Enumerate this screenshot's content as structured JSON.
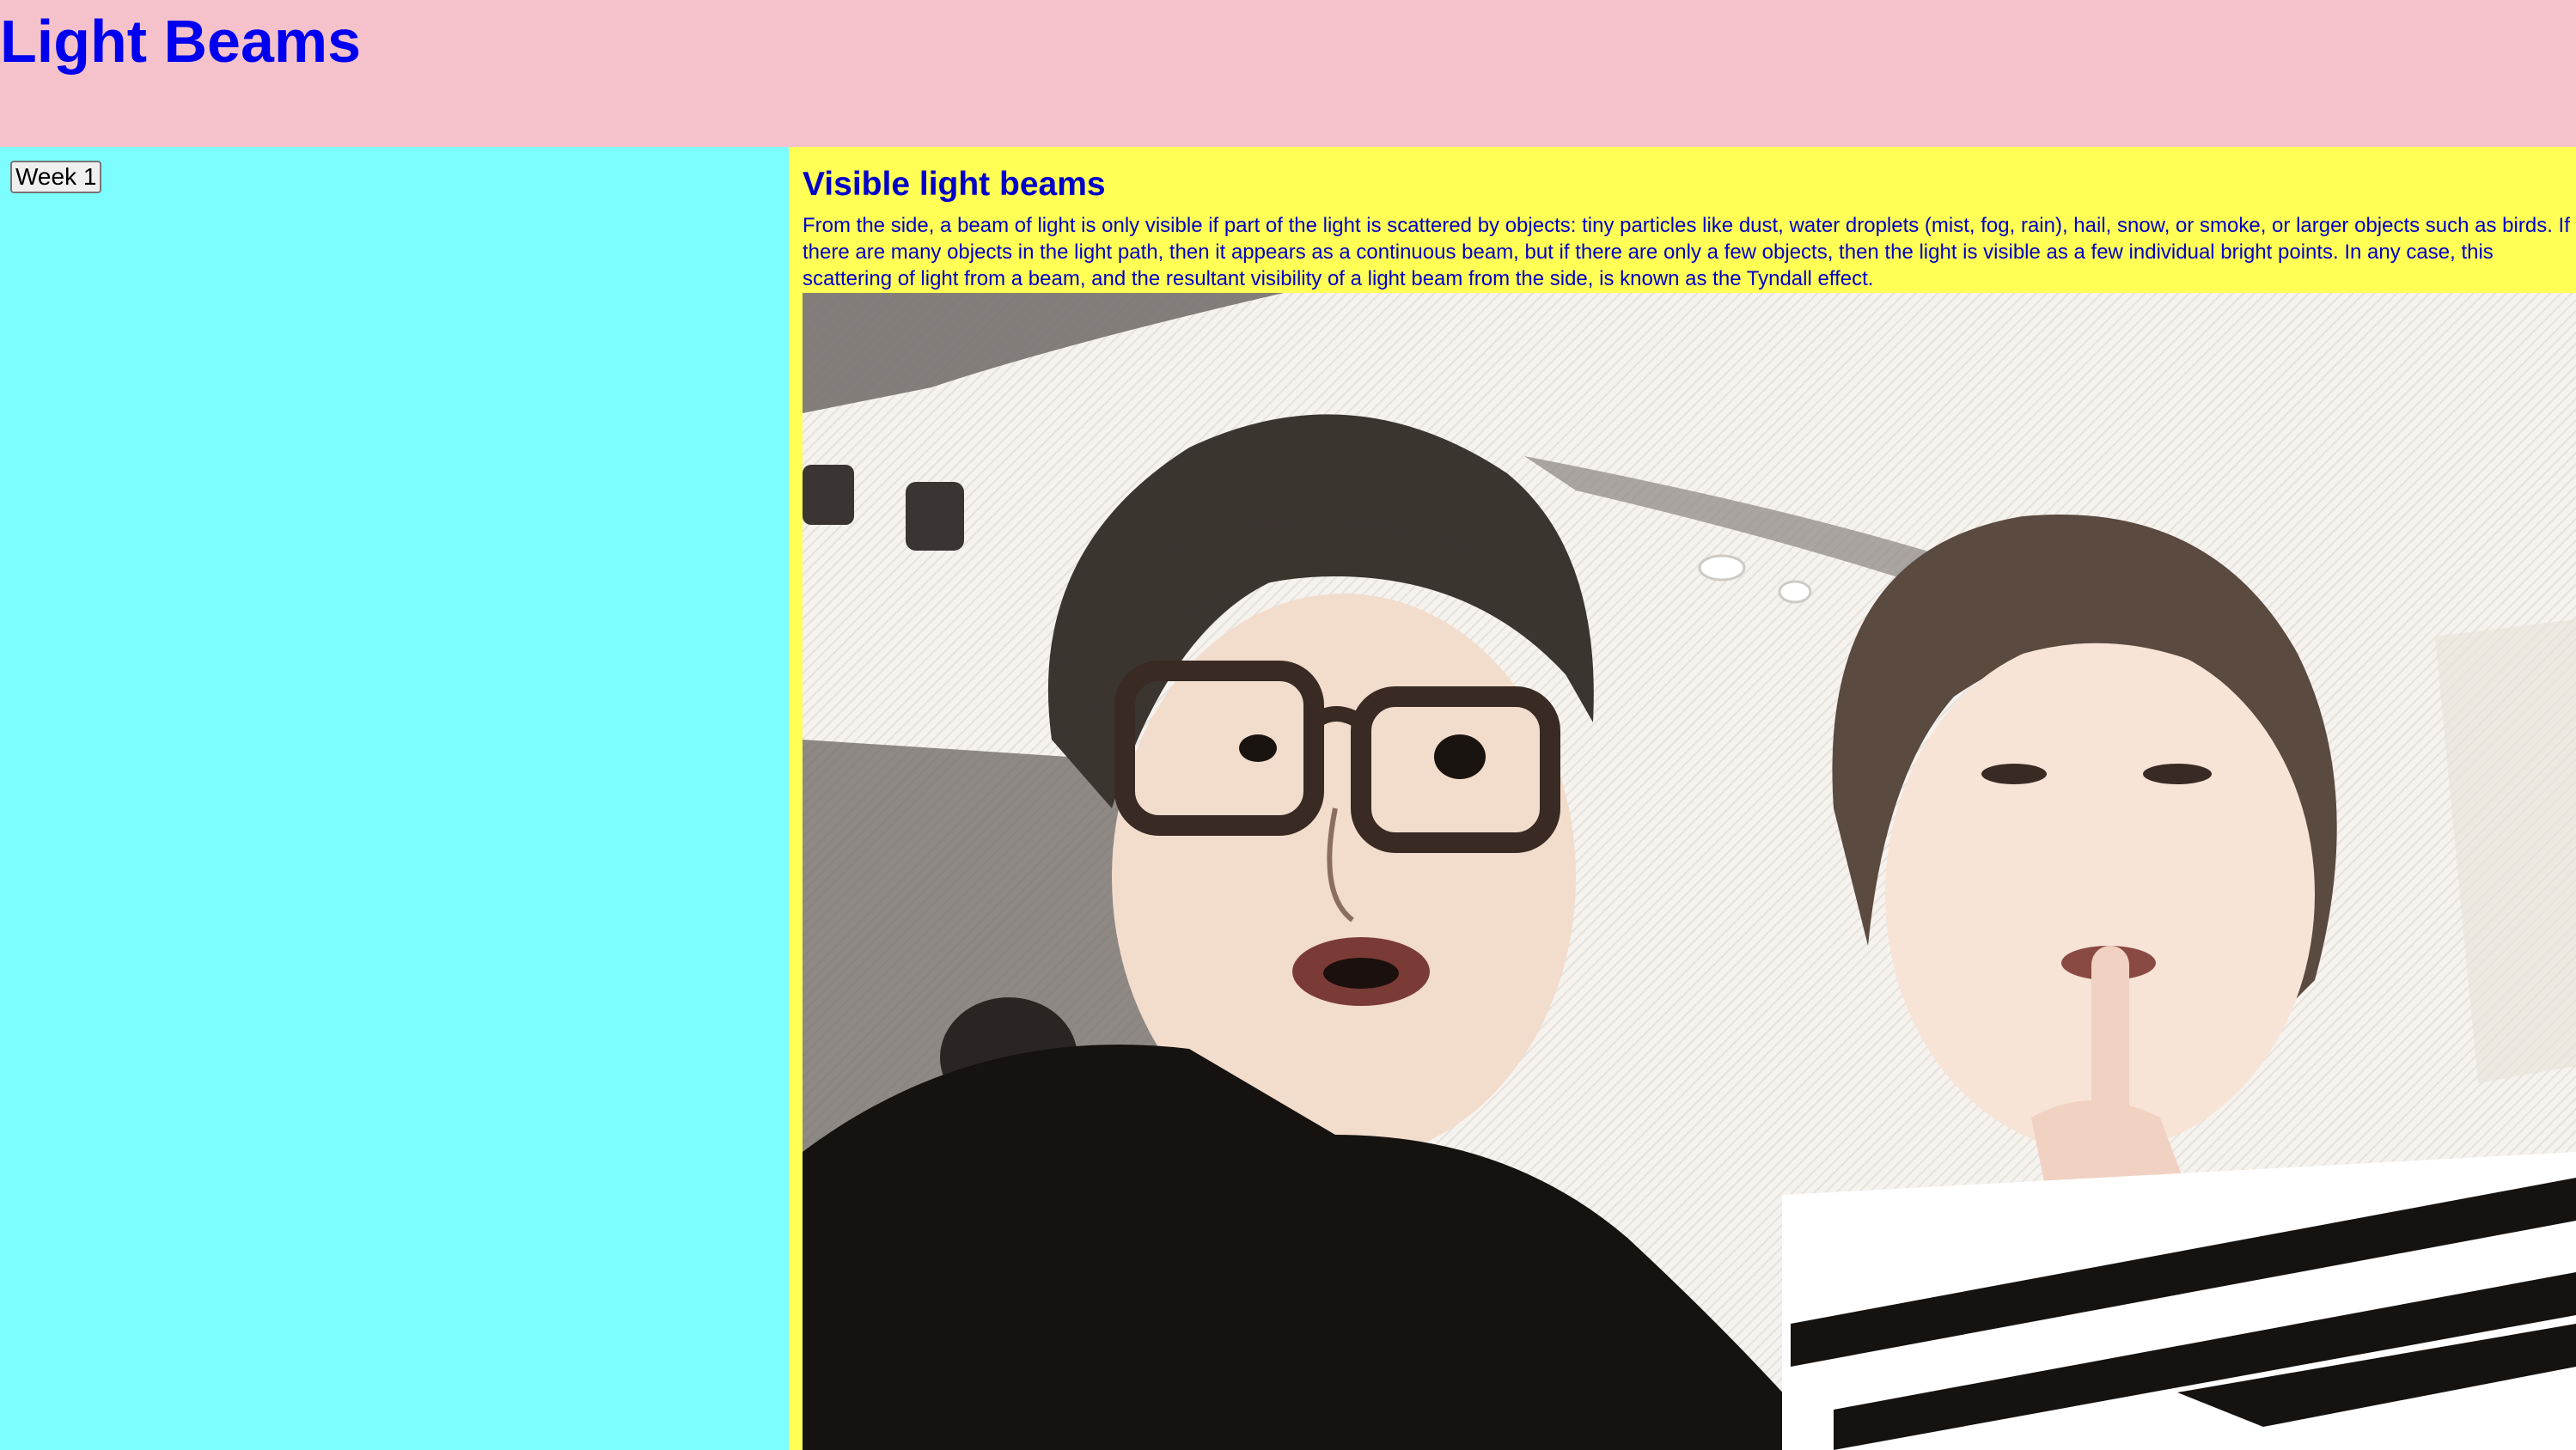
{
  "header": {
    "title": "Light Beams"
  },
  "sidebar": {
    "week_button_label": "Week 1"
  },
  "main": {
    "heading": "Visible light beams",
    "paragraph": "From the side, a beam of light is only visible if part of the light is scattered by objects: tiny particles like dust, water droplets (mist, fog, rain), hail, snow, or smoke, or larger objects such as birds. If there are many objects in the light path, then it appears as a continuous beam, but if there are only a few objects, then the light is visible as a few individual bright points. In any case, this scattering of light from a beam, and the resultant visibility of a light beam from the side, is known as the Tyndall effect."
  },
  "colors": {
    "header_bg": "#f5c2cb",
    "sidebar_bg": "#7dfdfe",
    "main_bg": "#ffff55",
    "title_color": "#0000ee",
    "text_color": "#0000c8"
  }
}
